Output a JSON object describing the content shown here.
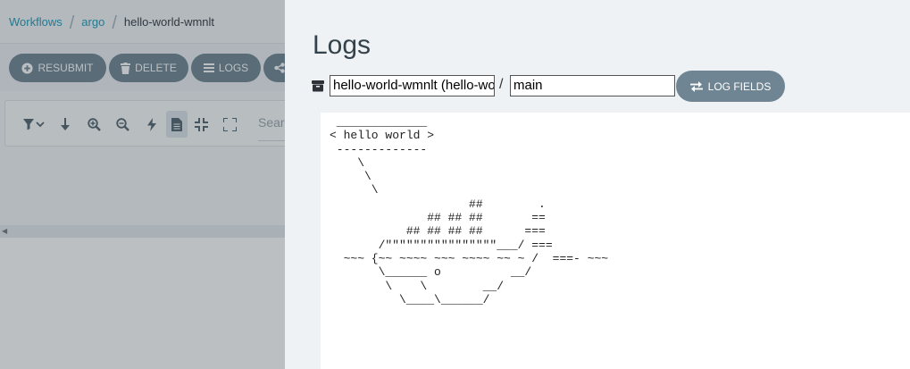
{
  "breadcrumb": {
    "items": [
      "Workflows",
      "argo",
      "hello-world-wmnlt"
    ]
  },
  "actions": {
    "resubmit": "RESUBMIT",
    "delete": "DELETE",
    "logs": "LOGS"
  },
  "toolbar": {
    "search_placeholder": "Search"
  },
  "logs": {
    "title": "Logs",
    "pod": "hello-world-wmnlt (hello-world-wmnlt)",
    "container": "main",
    "log_fields": "LOG FIELDS",
    "lines": [
      " _____________ ",
      "< hello world >",
      " ------------- ",
      "    \\",
      "     \\",
      "      \\",
      "                    ##        .",
      "              ## ## ##       ==",
      "           ## ## ## ##      ===",
      "       /\"\"\"\"\"\"\"\"\"\"\"\"\"\"\"\"___/ ===",
      "  ~~~ {~~ ~~~~ ~~~ ~~~~ ~~ ~ /  ===- ~~~",
      "       \\______ o          __/",
      "        \\    \\        __/",
      "          \\____\\______/"
    ]
  },
  "colors": {
    "button": "#6f8593",
    "link": "#1f9ab8",
    "panel_bg": "#eef2f5"
  }
}
